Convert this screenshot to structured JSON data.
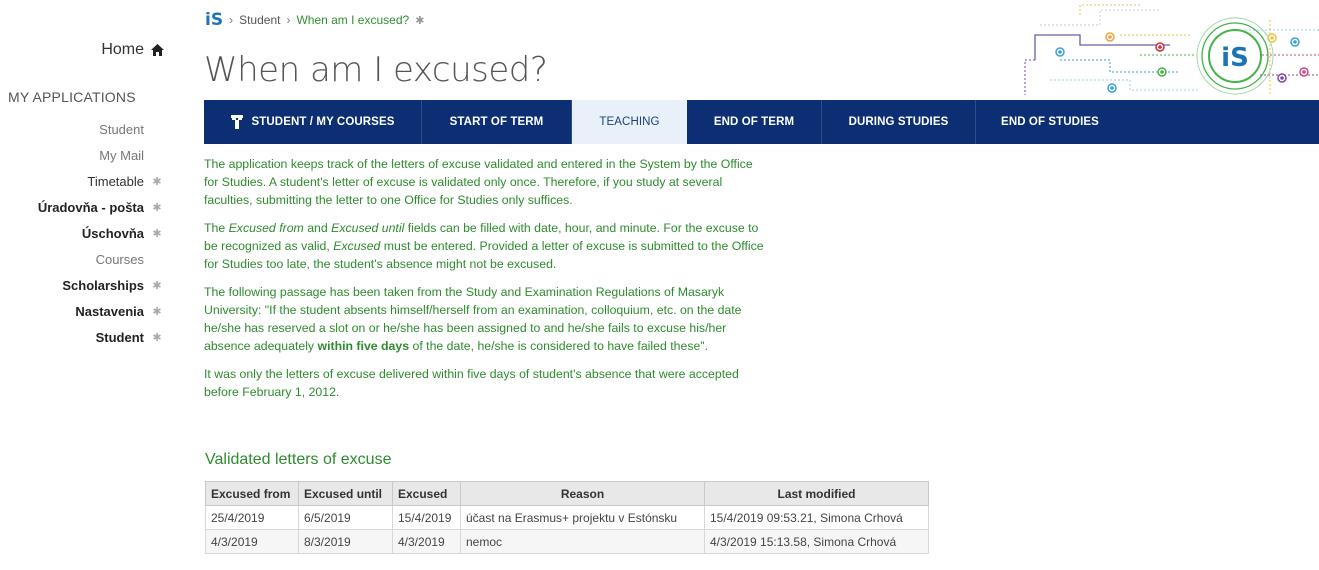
{
  "sidebar": {
    "home": "Home",
    "section_title": "MY APPLICATIONS",
    "items": [
      {
        "label": "Student",
        "style": "light",
        "pinned": false
      },
      {
        "label": "My Mail",
        "style": "light",
        "pinned": false
      },
      {
        "label": "Timetable",
        "style": "dark-normal",
        "pinned": true
      },
      {
        "label": "Úradovňa - pošta",
        "style": "dark",
        "pinned": true
      },
      {
        "label": "Úschovňa",
        "style": "dark",
        "pinned": true
      },
      {
        "label": "Courses",
        "style": "light",
        "pinned": false
      },
      {
        "label": "Scholarships",
        "style": "dark",
        "pinned": true
      },
      {
        "label": "Nastavenia",
        "style": "dark",
        "pinned": true
      },
      {
        "label": "Student",
        "style": "dark",
        "pinned": true
      }
    ]
  },
  "breadcrumb": {
    "logo": "iS",
    "items": [
      "Student",
      "When am I excused?"
    ]
  },
  "page": {
    "title": "When am I excused?"
  },
  "tabs": [
    {
      "label": "STUDENT / MY COURSES",
      "active": false,
      "icon": "pillar-icon"
    },
    {
      "label": "START OF TERM",
      "active": false
    },
    {
      "label": "TEACHING",
      "active": true
    },
    {
      "label": "END OF TERM",
      "active": false
    },
    {
      "label": "DURING STUDIES",
      "active": false
    },
    {
      "label": "END OF STUDIES",
      "active": false
    }
  ],
  "content": {
    "p1": "The application keeps track of the letters of excuse validated and entered in the System by the Office for Studies. A student's letter of excuse is validated only once. Therefore, if you study at several faculties, submitting the letter to one Office for Studies only suffices.",
    "p2_a": "The ",
    "p2_em1": "Excused from",
    "p2_b": " and ",
    "p2_em2": "Excused until",
    "p2_c": " fields can be filled with date, hour, and minute. For the excuse to be recognized as valid, ",
    "p2_em3": "Excused",
    "p2_d": " must be entered. Provided a letter of excuse is submitted to the Office for Studies too late, the student's absence might not be excused.",
    "p3_a": "The following passage has been taken from the Study and Examination Regulations of Masaryk University: \"If the student absents himself/herself from an examination, colloquium, etc. on the date he/she has reserved a slot on or he/she has been assigned to and he/she fails to excuse his/her absence adequately ",
    "p3_b": "within five days",
    "p3_c": " of the date, he/she is considered to have failed these\".",
    "p4": "It was only the letters of excuse delivered within five days of student's absence that were accepted before February 1, 2012."
  },
  "table": {
    "heading": "Validated letters of excuse",
    "headers": [
      "Excused from",
      "Excused until",
      "Excused",
      "Reason",
      "Last modified"
    ],
    "rows": [
      [
        "25/4/2019",
        "6/5/2019",
        "15/4/2019",
        "účast na Erasmus+ projektu v Estónsku",
        "15/4/2019 09:53.21, Simona Crhová"
      ],
      [
        "4/3/2019",
        "8/3/2019",
        "4/3/2019",
        "nemoc",
        "4/3/2019 15:13.58, Simona Crhová"
      ]
    ]
  },
  "colors": {
    "navy": "#0c2f73",
    "green_text": "#2e8b2e",
    "active_tab_bg": "#e8f1fa",
    "logo_blue": "#1b74b6"
  }
}
